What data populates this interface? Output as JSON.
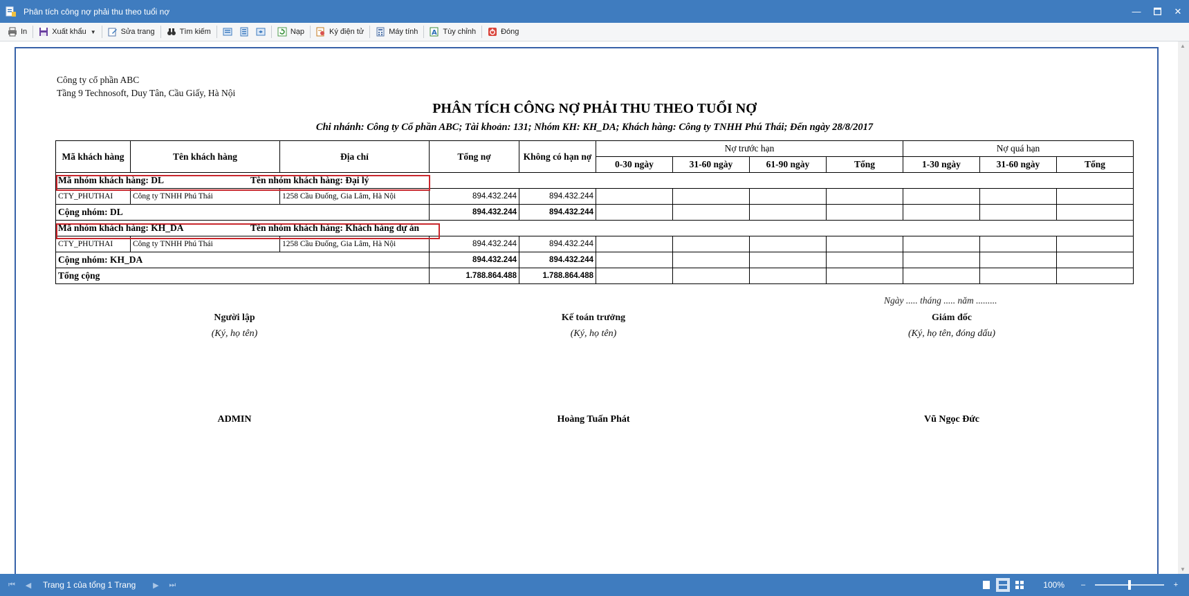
{
  "window": {
    "title": "Phân tích công nợ phải thu theo tuổi nợ"
  },
  "toolbar": {
    "print": "In",
    "export": "Xuất khẩu",
    "edit_page": "Sửa trang",
    "search": "Tìm kiếm",
    "reload": "Nạp",
    "e_sign": "Ký điện tử",
    "calculator": "Máy tính",
    "customize": "Tùy chỉnh",
    "close": "Đóng"
  },
  "report": {
    "company_name": "Công ty cổ phần ABC",
    "company_address": "Tầng 9 Technosoft, Duy Tân, Cầu Giấy, Hà Nội",
    "title": "PHÂN TÍCH CÔNG NỢ PHẢI THU THEO TUỔI NỢ",
    "subtitle": "Chi nhánh: Công ty Cổ phần ABC; Tài khoản: 131; Nhóm KH: KH_DA; Khách hàng: Công ty TNHH Phú Thái; Đến ngày 28/8/2017",
    "headers": {
      "customer_code": "Mã khách hàng",
      "customer_name": "Tên khách hàng",
      "address": "Địa chỉ",
      "total_debt": "Tổng nợ",
      "no_term": "Không có hạn nợ",
      "before_due": "Nợ trước hạn",
      "overdue": "Nợ quá hạn",
      "d0_30": "0-30 ngày",
      "d31_60": "31-60 ngày",
      "d61_90": "61-90 ngày",
      "sum": "Tổng",
      "d1_30": "1-30 ngày",
      "d31_60b": "31-60 ngày",
      "sum2": "Tổng"
    },
    "groups": [
      {
        "code_label": "Mã nhóm khách hàng: DL",
        "name_label": "Tên nhóm khách hàng: Đại lý",
        "row": {
          "code": "CTY_PHUTHAI",
          "name": "Công ty TNHH Phú Thái",
          "address": "1258 Cầu Đuống, Gia Lâm, Hà Nội",
          "total": "894.432.244",
          "no_term": "894.432.244"
        },
        "subtotal_label": "Cộng nhóm: DL",
        "subtotal_total": "894.432.244",
        "subtotal_no_term": "894.432.244"
      },
      {
        "code_label": "Mã nhóm khách hàng: KH_DA",
        "name_label": "Tên nhóm khách hàng: Khách hàng dự án",
        "row": {
          "code": "CTY_PHUTHAI",
          "name": "Công ty TNHH Phú Thái",
          "address": "1258 Cầu Đuống, Gia Lâm, Hà Nội",
          "total": "894.432.244",
          "no_term": "894.432.244"
        },
        "subtotal_label": "Cộng nhóm: KH_DA",
        "subtotal_total": "894.432.244",
        "subtotal_no_term": "894.432.244"
      }
    ],
    "grand_total_label": "Tổng cộng",
    "grand_total": "1.788.864.488",
    "grand_no_term": "1.788.864.488",
    "signature": {
      "date_line": "Ngày ..... tháng ..... năm .........",
      "preparer_title": "Người lập",
      "preparer_note": "(Ký, họ tên)",
      "preparer_name": "ADMIN",
      "accountant_title": "Kế toán trưởng",
      "accountant_note": "(Ký, họ tên)",
      "accountant_name": "Hoàng Tuấn Phát",
      "director_title": "Giám đốc",
      "director_note": "(Ký, họ tên, đóng dấu)",
      "director_name": "Vũ Ngọc Đức"
    }
  },
  "statusbar": {
    "page_info": "Trang 1 của tổng 1 Trang",
    "zoom": "100%"
  },
  "colors": {
    "titlebar": "#3f7cbf",
    "highlight_box": "#c9272d",
    "page_border": "#3661a8"
  }
}
